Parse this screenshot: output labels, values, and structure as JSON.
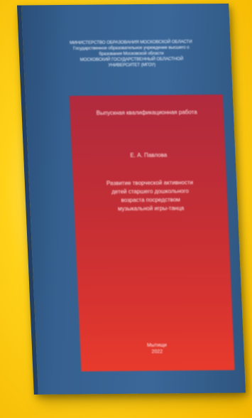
{
  "cover": {
    "header": [
      "МИНИСТЕРСТВО ОБРАЗОВАНИЯ МОСКОВСКОЙ ОБЛАСТИ",
      "Государственное образовательное учреждение высшего о",
      "бразования Московской области",
      "МОСКОВСКИЙ ГОСУДАРСТВЕННЫЙ ОБЛАСТНОЙ",
      "УНИВЕРСИТЕТ (МГОУ)"
    ],
    "work_type": "Выпускная квалификационная работа",
    "author": "Е. А. Павлова",
    "topic": [
      "Развитие творческой активности",
      "детей старшего дошкольного",
      "возраста посредством",
      "музыкальной игры-танца"
    ],
    "city": "Мытищи",
    "year": "2022"
  },
  "colors": {
    "background": "#ffd21a",
    "book_blue": "#3a6799",
    "panel_red": "#d63330"
  }
}
